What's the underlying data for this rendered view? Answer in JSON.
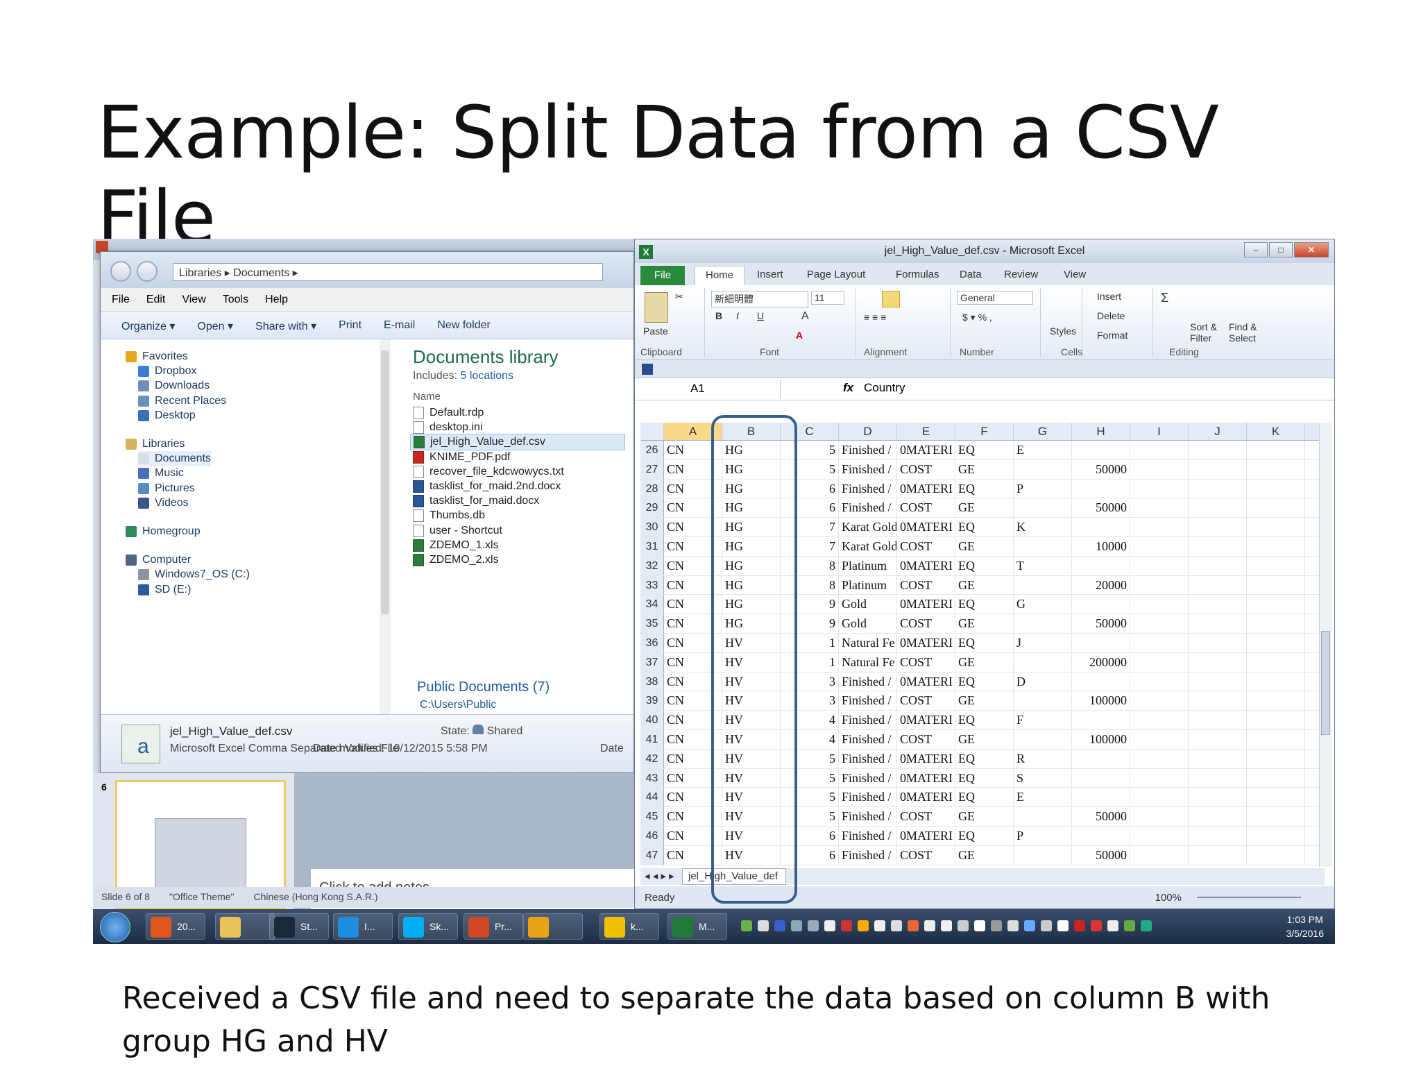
{
  "slide": {
    "title": "Example: Split Data from a CSV File",
    "caption": "Received a CSV file and need to separate the data based on column B with group HG and HV"
  },
  "explorer": {
    "breadcrumb": "Libraries  ▸  Documents  ▸",
    "menu": [
      "File",
      "Edit",
      "View",
      "Tools",
      "Help"
    ],
    "commands": [
      "Organize ▾",
      "Open ▾",
      "Share with ▾",
      "Print",
      "E-mail",
      "New folder"
    ],
    "tree": [
      {
        "label": "Favorites",
        "color": "#e6a81e",
        "child": false
      },
      {
        "label": "Dropbox",
        "color": "#3a7bd5",
        "child": true
      },
      {
        "label": "Downloads",
        "color": "#6d8fc0",
        "child": true
      },
      {
        "label": "Recent Places",
        "color": "#6d8fc0",
        "child": true
      },
      {
        "label": "Desktop",
        "color": "#3c6fb5",
        "child": true
      },
      {
        "label": "Libraries",
        "color": "#d7b45c",
        "child": false
      },
      {
        "label": "Documents",
        "color": "#d9dfe8",
        "child": true,
        "selected": true
      },
      {
        "label": "Music",
        "color": "#4a6fbf",
        "child": true
      },
      {
        "label": "Pictures",
        "color": "#5b8bc7",
        "child": true
      },
      {
        "label": "Videos",
        "color": "#3b5587",
        "child": true
      },
      {
        "label": "Homegroup",
        "color": "#2f8a5e",
        "child": false
      },
      {
        "label": "Computer",
        "color": "#4d6585",
        "child": false
      },
      {
        "label": "Windows7_OS (C:)",
        "color": "#8893a3",
        "child": true
      },
      {
        "label": "SD (E:)",
        "color": "#2c5aa0",
        "child": true
      }
    ],
    "library_title": "Documents library",
    "includes_label": "Includes:",
    "includes_link": "5 locations",
    "name_col": "Name",
    "files": [
      {
        "name": "Default.rdp",
        "type": "gen"
      },
      {
        "name": "desktop.ini",
        "type": "gen"
      },
      {
        "name": "jel_High_Value_def.csv",
        "type": "xl",
        "selected": true
      },
      {
        "name": "KNIME_PDF.pdf",
        "type": "pdf"
      },
      {
        "name": "recover_file_kdcwowycs.txt",
        "type": "gen"
      },
      {
        "name": "tasklist_for_maid.2nd.docx",
        "type": "doc"
      },
      {
        "name": "tasklist_for_maid.docx",
        "type": "doc"
      },
      {
        "name": "Thumbs.db",
        "type": "gen"
      },
      {
        "name": "user - Shortcut",
        "type": "gen"
      },
      {
        "name": "ZDEMO_1.xls",
        "type": "xl"
      },
      {
        "name": "ZDEMO_2.xls",
        "type": "xl"
      }
    ],
    "public_docs": "Public Documents (7)",
    "public_path": "C:\\Users\\Public",
    "details": {
      "filename": "jel_High_Value_def.csv",
      "filetype": "Microsoft Excel Comma Separated Values File",
      "state_label": "State:",
      "state_value": "Shared",
      "modified": "Date modified: 10/12/2015 5:58 PM",
      "date_trunc": "Date"
    }
  },
  "powerpoint": {
    "slide_number": "6",
    "notes_placeholder": "Click to add notes",
    "status": [
      "Slide 6 of 8",
      "\"Office Theme\"",
      "Chinese (Hong Kong S.A.R.)"
    ]
  },
  "excel": {
    "title": "jel_High_Value_def.csv  -  Microsoft Excel",
    "tabs": [
      "File",
      "Home",
      "Insert",
      "Page Layout",
      "Formulas",
      "Data",
      "Review",
      "View"
    ],
    "ribbon": {
      "paste": "Paste",
      "font_name": "新細明體",
      "font_size": "11",
      "number_format": "General",
      "styles": "Styles",
      "insert": "Insert",
      "delete": "Delete",
      "format": "Format",
      "sort": "Sort &\nFilter",
      "find": "Find &\nSelect",
      "groups": [
        "Clipboard",
        "Font",
        "Alignment",
        "Number",
        "Cells",
        "Editing"
      ]
    },
    "name_box": "A1",
    "formula_value": "Country",
    "columns": [
      "A",
      "B",
      "C",
      "D",
      "E",
      "F",
      "G",
      "H",
      "I",
      "J",
      "K"
    ],
    "rows": [
      [
        "26",
        "CN",
        "HG",
        "5",
        "Finished /",
        "0MATERI",
        "EQ",
        "E",
        ""
      ],
      [
        "27",
        "CN",
        "HG",
        "5",
        "Finished /",
        "COST",
        "GE",
        "",
        "50000"
      ],
      [
        "28",
        "CN",
        "HG",
        "6",
        "Finished /",
        "0MATERI",
        "EQ",
        "P",
        ""
      ],
      [
        "29",
        "CN",
        "HG",
        "6",
        "Finished /",
        "COST",
        "GE",
        "",
        "50000"
      ],
      [
        "30",
        "CN",
        "HG",
        "7",
        "Karat Gold",
        "0MATERI",
        "EQ",
        "K",
        ""
      ],
      [
        "31",
        "CN",
        "HG",
        "7",
        "Karat Gold",
        "COST",
        "GE",
        "",
        "10000"
      ],
      [
        "32",
        "CN",
        "HG",
        "8",
        "Platinum",
        "0MATERI",
        "EQ",
        "T",
        ""
      ],
      [
        "33",
        "CN",
        "HG",
        "8",
        "Platinum",
        "COST",
        "GE",
        "",
        "20000"
      ],
      [
        "34",
        "CN",
        "HG",
        "9",
        "Gold",
        "0MATERI",
        "EQ",
        "G",
        ""
      ],
      [
        "35",
        "CN",
        "HG",
        "9",
        "Gold",
        "COST",
        "GE",
        "",
        "50000"
      ],
      [
        "36",
        "CN",
        "HV",
        "1",
        "Natural Fe",
        "0MATERI",
        "EQ",
        "J",
        ""
      ],
      [
        "37",
        "CN",
        "HV",
        "1",
        "Natural Fe",
        "COST",
        "GE",
        "",
        "200000"
      ],
      [
        "38",
        "CN",
        "HV",
        "3",
        "Finished /",
        "0MATERI",
        "EQ",
        "D",
        ""
      ],
      [
        "39",
        "CN",
        "HV",
        "3",
        "Finished /",
        "COST",
        "GE",
        "",
        "100000"
      ],
      [
        "40",
        "CN",
        "HV",
        "4",
        "Finished /",
        "0MATERI",
        "EQ",
        "F",
        ""
      ],
      [
        "41",
        "CN",
        "HV",
        "4",
        "Finished /",
        "COST",
        "GE",
        "",
        "100000"
      ],
      [
        "42",
        "CN",
        "HV",
        "5",
        "Finished /",
        "0MATERI",
        "EQ",
        "R",
        ""
      ],
      [
        "43",
        "CN",
        "HV",
        "5",
        "Finished /",
        "0MATERI",
        "EQ",
        "S",
        ""
      ],
      [
        "44",
        "CN",
        "HV",
        "5",
        "Finished /",
        "0MATERI",
        "EQ",
        "E",
        ""
      ],
      [
        "45",
        "CN",
        "HV",
        "5",
        "Finished /",
        "COST",
        "GE",
        "",
        "50000"
      ],
      [
        "46",
        "CN",
        "HV",
        "6",
        "Finished /",
        "0MATERI",
        "EQ",
        "P",
        ""
      ],
      [
        "47",
        "CN",
        "HV",
        "6",
        "Finished /",
        "COST",
        "GE",
        "",
        "50000"
      ]
    ],
    "sheet_tab": "jel_High_Value_def",
    "status_ready": "Ready",
    "zoom": "100%"
  },
  "taskbar": {
    "buttons": [
      {
        "label": "20...",
        "color": "#e0561f"
      },
      {
        "label": "",
        "color": "#e8c35a"
      },
      {
        "label": "St...",
        "color": "#1b2838"
      },
      {
        "label": "I...",
        "color": "#1e8ce0"
      },
      {
        "label": "Sk...",
        "color": "#00aff0"
      },
      {
        "label": "Pr...",
        "color": "#d24726"
      },
      {
        "label": "",
        "color": "#e8a317"
      },
      {
        "label": "k...",
        "color": "#f2c200"
      },
      {
        "label": "M...",
        "color": "#1f7a3a"
      }
    ],
    "time": "1:03 PM",
    "date": "3/5/2016"
  }
}
